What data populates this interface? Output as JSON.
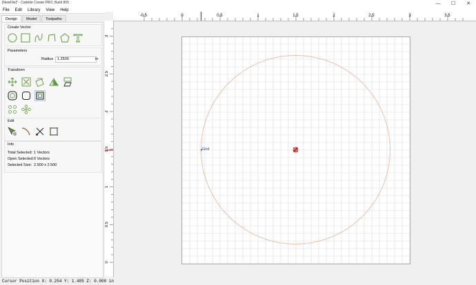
{
  "window": {
    "title": "[NewFile]* - Carbide Create PRO, Build 805",
    "minimize": "—",
    "maximize": "☐",
    "close": "✕"
  },
  "menu": [
    "File",
    "Edit",
    "Library",
    "View",
    "Help"
  ],
  "tabs": [
    "Design",
    "Model",
    "Toolpaths"
  ],
  "sections": {
    "create_vector": "Create Vector",
    "parameters": "Parameters",
    "transform": "Transform",
    "edit": "Edit",
    "info": "Info"
  },
  "parameters": {
    "radius_label": "Radius",
    "radius_value": "1.2500",
    "unit": "in"
  },
  "info": [
    {
      "label": "Total Selected:",
      "value": "1 Vectors"
    },
    {
      "label": "Open Selected:",
      "value": "0 Vectors"
    },
    {
      "label": "Selected Size:",
      "value": "2.500 x 2.500"
    }
  ],
  "ruler": {
    "h_ticks": [
      "-0.5",
      "0",
      "0.5",
      "1",
      "1.5",
      "2",
      "2.5",
      "3",
      "3.5"
    ],
    "v_ticks": [
      "3",
      "2.5",
      "2",
      "1.5",
      "1",
      "0.5",
      "0"
    ]
  },
  "canvas": {
    "grid_label": "Grid",
    "circle_color": "#e0a080"
  },
  "status": "Cursor Position X: 0.254 Y: 1.485 Z: 0.000 in",
  "colors": {
    "accent": "#5a9a3a",
    "cursor_line": "#c00000"
  }
}
